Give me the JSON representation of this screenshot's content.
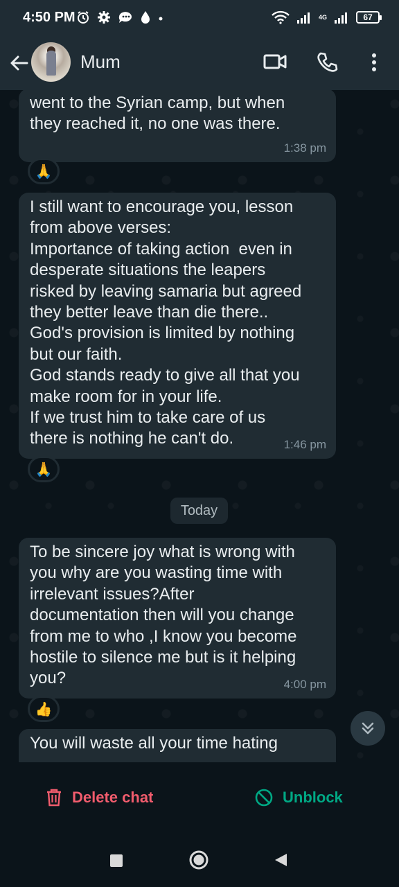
{
  "status_bar": {
    "time": "4:50 PM",
    "network": "4G",
    "battery": "67"
  },
  "header": {
    "contact_name": "Mum"
  },
  "messages": [
    {
      "text": "went to the Syrian camp, but when\nthey reached it, no one was there.",
      "time": "1:38 pm",
      "reaction": "🙏"
    },
    {
      "text": "I still want to encourage you, lesson\nfrom above verses:\nImportance of taking action  even in\ndesperate situations the leapers\nrisked by leaving samaria but agreed\nthey better leave than die there..\nGod's provision is limited by nothing\nbut our faith.\nGod stands ready to give all that you\nmake room for in your life.\nIf we trust him to take care of us\nthere is nothing he can't do.",
      "time": "1:46 pm",
      "reaction": "🙏"
    },
    {
      "text": "To be sincere joy what is wrong with\nyou why are you wasting time with\nirrelevant issues?After\ndocumentation then will you change\nfrom me to who ,I know you become\nhostile to silence me but is it helping\nyou?",
      "time": "4:00 pm",
      "reaction": "👍"
    },
    {
      "text": "You will waste all your time hating",
      "time": "",
      "reaction": ""
    }
  ],
  "date_separator": "Today",
  "bottom_actions": {
    "delete_label": "Delete chat",
    "unblock_label": "Unblock"
  },
  "colors": {
    "delete": "#f15c6d",
    "unblock": "#00a884",
    "bubble": "#202c33",
    "background": "#0b141a"
  }
}
